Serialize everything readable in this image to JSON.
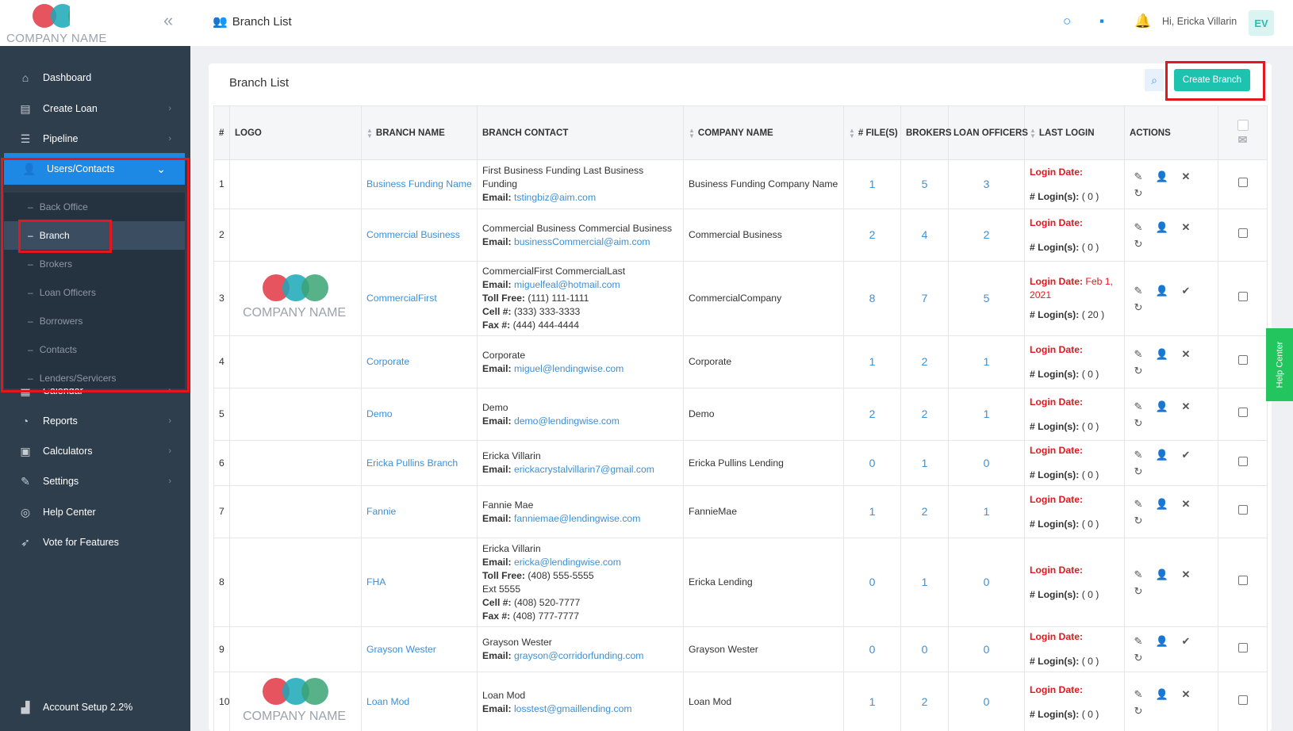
{
  "brand": {
    "name": "COMPANY NAME",
    "colors": {
      "red": "#e3424e",
      "teal": "#1aa8b8",
      "green": "#3aa374"
    }
  },
  "sidebar": {
    "items": [
      {
        "label": "Dashboard",
        "icon": "home-icon",
        "chevron": false
      },
      {
        "label": "Create Loan",
        "icon": "document-icon",
        "chevron": true
      },
      {
        "label": "Pipeline",
        "icon": "list-icon",
        "chevron": true
      },
      {
        "label": "Users/Contacts",
        "icon": "users-icon",
        "chevron": true,
        "active": true
      },
      {
        "label": "Calendar",
        "icon": "calendar-icon",
        "chevron": true
      },
      {
        "label": "Reports",
        "icon": "reports-icon",
        "chevron": true
      },
      {
        "label": "Calculators",
        "icon": "calculator-icon",
        "chevron": true
      },
      {
        "label": "Settings",
        "icon": "wrench-icon",
        "chevron": true
      },
      {
        "label": "Help Center",
        "icon": "help-icon",
        "chevron": false
      },
      {
        "label": "Vote for Features",
        "icon": "rocket-icon",
        "chevron": false
      }
    ],
    "subitems": [
      "Back Office",
      "Branch",
      "Brokers",
      "Loan Officers",
      "Borrowers",
      "Contacts",
      "Lenders/Servicers"
    ],
    "footer": "Account Setup 2.2%"
  },
  "header": {
    "title": "Branch List",
    "greeting": "Hi, Ericka Villarin",
    "avatar": "EV"
  },
  "card": {
    "title": "Branch List",
    "create_label": "Create Branch"
  },
  "table": {
    "columns": [
      "#",
      "LOGO",
      "BRANCH NAME",
      "BRANCH CONTACT",
      "COMPANY NAME",
      "# FILE(S)",
      "BROKERS",
      "LOAN OFFICERS",
      "LAST LOGIN",
      "ACTIONS"
    ],
    "login_date_label": "Login Date:",
    "logins_label": "# Login(s):",
    "rows": [
      {
        "n": "1",
        "logo": false,
        "branch": "Business Funding Name",
        "contact": [
          {
            "t": "First Business Funding Last Business Funding"
          },
          {
            "k": "Email:",
            "v": "tstingbiz@aim.com",
            "link": true
          }
        ],
        "company": "Business Funding Company Name",
        "files": "1",
        "brokers": "5",
        "officers": "3",
        "login_date": "",
        "logins": "( 0 )",
        "third": "x"
      },
      {
        "n": "2",
        "logo": false,
        "branch": "Commercial Business",
        "contact": [
          {
            "t": "Commercial Business Commercial Business"
          },
          {
            "k": "Email:",
            "v": "businessCommercial@aim.com",
            "link": true
          }
        ],
        "company": "Commercial Business",
        "files": "2",
        "brokers": "4",
        "officers": "2",
        "login_date": "",
        "logins": "( 0 )",
        "third": "x"
      },
      {
        "n": "3",
        "logo": true,
        "branch": "CommercialFirst",
        "contact": [
          {
            "t": "CommercialFirst CommercialLast"
          },
          {
            "k": "Email:",
            "v": "miguelfeal@hotmail.com",
            "link": true
          },
          {
            "k": "Toll Free:",
            "v": "(111) 111-1111"
          },
          {
            "k": "Cell #:",
            "v": "(333) 333-3333"
          },
          {
            "k": "Fax #:",
            "v": "(444) 444-4444"
          }
        ],
        "company": "CommercialCompany",
        "files": "8",
        "brokers": "7",
        "officers": "5",
        "login_date": "Feb 1, 2021",
        "logins": "( 20 )",
        "third": "check"
      },
      {
        "n": "4",
        "logo": false,
        "branch": "Corporate",
        "contact": [
          {
            "t": "Corporate"
          },
          {
            "k": "Email:",
            "v": "miguel@lendingwise.com",
            "link": true
          }
        ],
        "company": "Corporate",
        "files": "1",
        "brokers": "2",
        "officers": "1",
        "login_date": "",
        "logins": "( 0 )",
        "third": "x"
      },
      {
        "n": "5",
        "logo": false,
        "branch": "Demo",
        "contact": [
          {
            "t": "Demo"
          },
          {
            "k": "Email:",
            "v": "demo@lendingwise.com",
            "link": true
          }
        ],
        "company": "Demo",
        "files": "2",
        "brokers": "2",
        "officers": "1",
        "login_date": "",
        "logins": "( 0 )",
        "third": "x"
      },
      {
        "n": "6",
        "logo": false,
        "branch": "Ericka Pullins Branch",
        "contact": [
          {
            "t": "Ericka Villarin"
          },
          {
            "k": "Email:",
            "v": "erickacrystalvillarin7@gmail.com",
            "link": true
          }
        ],
        "company": "Ericka Pullins Lending",
        "files": "0",
        "brokers": "1",
        "officers": "0",
        "login_date": "",
        "logins": "( 0 )",
        "third": "check"
      },
      {
        "n": "7",
        "logo": false,
        "branch": "Fannie",
        "contact": [
          {
            "t": "Fannie Mae"
          },
          {
            "k": "Email:",
            "v": "fanniemae@lendingwise.com",
            "link": true
          }
        ],
        "company": "FannieMae",
        "files": "1",
        "brokers": "2",
        "officers": "1",
        "login_date": "",
        "logins": "( 0 )",
        "third": "x"
      },
      {
        "n": "8",
        "logo": false,
        "branch": "FHA",
        "contact": [
          {
            "t": "Ericka Villarin"
          },
          {
            "k": "Email:",
            "v": "ericka@lendingwise.com",
            "link": true
          },
          {
            "k": "Toll Free:",
            "v": "(408) 555-5555"
          },
          {
            "t": "Ext 5555"
          },
          {
            "k": "Cell #:",
            "v": "(408) 520-7777"
          },
          {
            "k": "Fax #:",
            "v": "(408) 777-7777"
          }
        ],
        "company": "Ericka Lending",
        "files": "0",
        "brokers": "1",
        "officers": "0",
        "login_date": "",
        "logins": "( 0 )",
        "third": "x"
      },
      {
        "n": "9",
        "logo": false,
        "branch": "Grayson Wester",
        "contact": [
          {
            "t": "Grayson Wester"
          },
          {
            "k": "Email:",
            "v": "grayson@corridorfunding.com",
            "link": true
          }
        ],
        "company": "Grayson Wester",
        "files": "0",
        "brokers": "0",
        "officers": "0",
        "login_date": "",
        "logins": "( 0 )",
        "third": "check"
      },
      {
        "n": "10",
        "logo": true,
        "branch": "Loan Mod",
        "contact": [
          {
            "t": "Loan Mod"
          },
          {
            "k": "Email:",
            "v": "losstest@gmaillending.com",
            "link": true
          }
        ],
        "company": "Loan Mod",
        "files": "1",
        "brokers": "2",
        "officers": "0",
        "login_date": "",
        "logins": "( 0 )",
        "third": "x"
      }
    ]
  },
  "help_tab": "Help Center"
}
